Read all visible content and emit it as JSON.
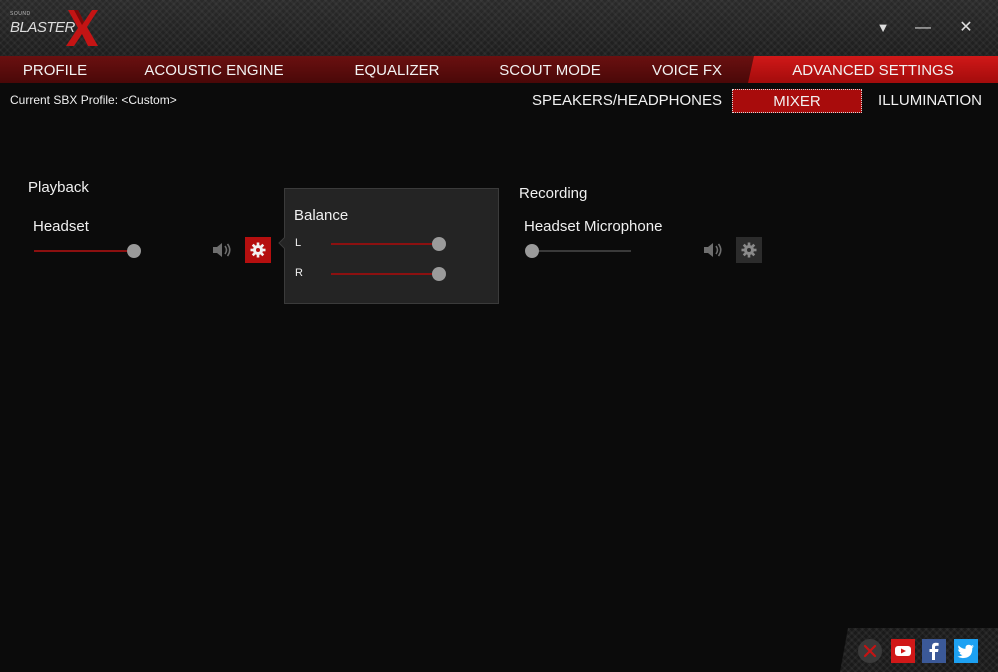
{
  "app": {
    "logo_small": "SOUND",
    "logo_word": "BLASTER",
    "accent": "#c41414"
  },
  "window": {
    "menu_glyph": "▼",
    "minimize_glyph": "—",
    "close_glyph": "✕"
  },
  "tabs": [
    {
      "label": "PROFILE"
    },
    {
      "label": "ACOUSTIC ENGINE"
    },
    {
      "label": "EQUALIZER"
    },
    {
      "label": "SCOUT MODE"
    },
    {
      "label": "VOICE FX"
    },
    {
      "label": "ADVANCED SETTINGS",
      "active": true
    }
  ],
  "profile": {
    "label": "Current SBX Profile: <Custom>"
  },
  "subtabs": [
    {
      "label": "SPEAKERS/HEADPHONES"
    },
    {
      "label": "MIXER",
      "active": true
    },
    {
      "label": "ILLUMINATION"
    }
  ],
  "playback": {
    "heading": "Playback",
    "device": "Headset",
    "volume_fraction": 1.0,
    "icons": [
      "speaker-icon",
      "gear-icon"
    ]
  },
  "balance": {
    "title": "Balance",
    "left_label": "L",
    "right_label": "R",
    "left_fraction": 1.0,
    "right_fraction": 1.0
  },
  "recording": {
    "heading": "Recording",
    "device": "Headset Microphone",
    "volume_fraction": 0.0,
    "icons": [
      "speaker-icon",
      "gear-icon"
    ]
  },
  "footer": {
    "icons": [
      "mute-icon",
      "youtube-icon",
      "facebook-icon",
      "twitter-icon"
    ]
  }
}
